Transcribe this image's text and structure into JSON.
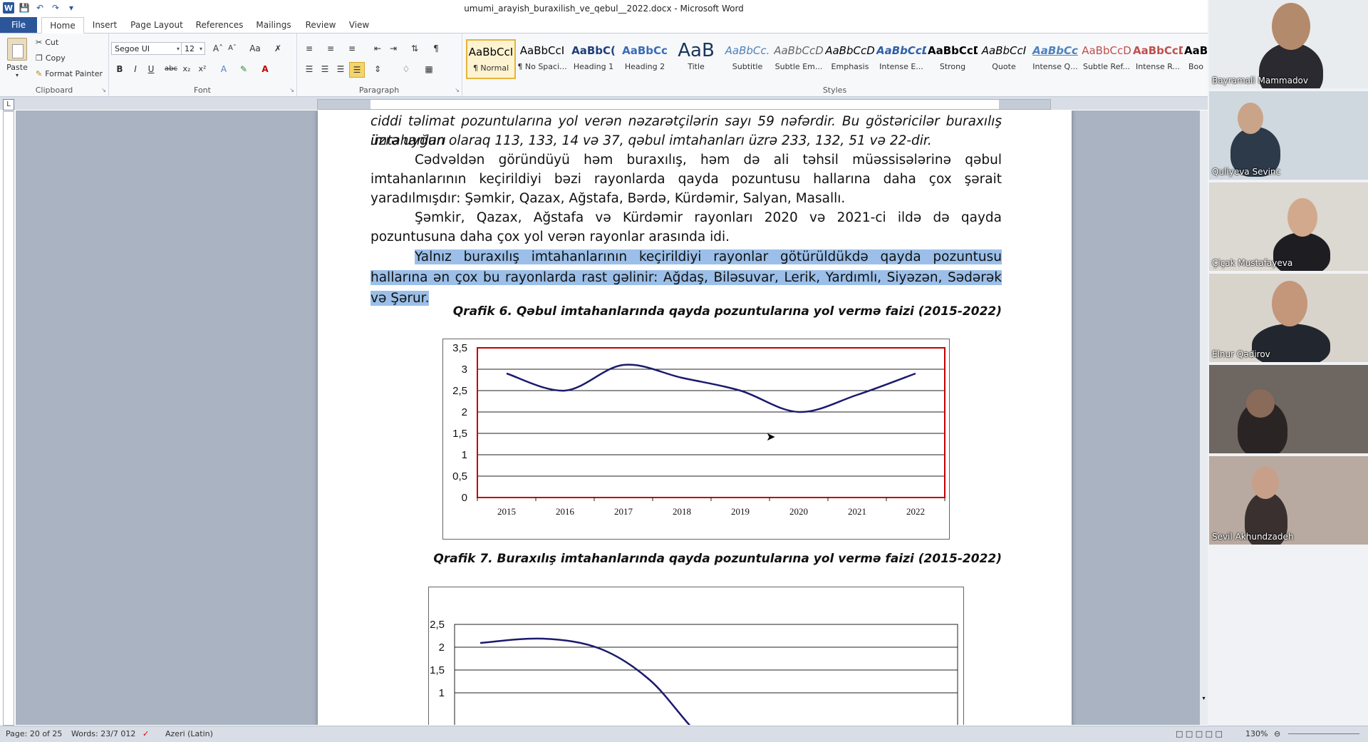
{
  "window": {
    "title": "umumi_arayish_buraxilish_ve_qebul__2022.docx - Microsoft Word",
    "app_icon_letter": "W"
  },
  "tabs": [
    "File",
    "Home",
    "Insert",
    "Page Layout",
    "References",
    "Mailings",
    "Review",
    "View"
  ],
  "ribbon": {
    "clipboard": {
      "paste": "Paste",
      "cut": "Cut",
      "copy": "Copy",
      "format_painter": "Format Painter",
      "label": "Clipboard"
    },
    "font": {
      "name": "Segoe UI",
      "size": "12",
      "label": "Font"
    },
    "paragraph": {
      "label": "Paragraph"
    },
    "styles": {
      "label": "Styles",
      "items": [
        {
          "sample": "AaBbCcI",
          "name": "¶ Normal"
        },
        {
          "sample": "AaBbCcI",
          "name": "¶ No Spaci..."
        },
        {
          "sample": "AaBbC(",
          "name": "Heading 1"
        },
        {
          "sample": "AaBbCc",
          "name": "Heading 2"
        },
        {
          "sample": "AaB",
          "name": "Title"
        },
        {
          "sample": "AaBbCc.",
          "name": "Subtitle"
        },
        {
          "sample": "AaBbCcD",
          "name": "Subtle Em..."
        },
        {
          "sample": "AaBbCcD",
          "name": "Emphasis"
        },
        {
          "sample": "AaBbCcD",
          "name": "Intense E..."
        },
        {
          "sample": "AaBbCcD",
          "name": "Strong"
        },
        {
          "sample": "AaBbCcI",
          "name": "Quote"
        },
        {
          "sample": "AaBbCc",
          "name": "Intense Q..."
        },
        {
          "sample": "AaBbCcD",
          "name": "Subtle Ref..."
        },
        {
          "sample": "AaBbCcD",
          "name": "Intense R..."
        },
        {
          "sample": "AaB",
          "name": "Boo"
        }
      ]
    }
  },
  "document": {
    "line1": "ciddi təlimat pozuntularına yol verən nəzarətçilərin sayı 59 nəfərdir.  Bu göstəricilər buraxılış imtahanları",
    "line2": "üzrə uyğun olaraq 113, 133, 14 və 37, qəbul imtahanları üzrə 233, 132, 51 və 22-dir.",
    "para2": "Cədvəldən göründüyü həm buraxılış, həm də ali təhsil müəssisələrinə qəbul imtahanlarının keçirildiyi bəzi rayonlarda qayda pozuntusu hallarına daha çox şərait yaradılmışdır: Şəmkir, Qazax, Ağstafa, Bərdə, Kürdəmir, Salyan, Masallı.",
    "para3": "Şəmkir, Qazax, Ağstafa və Kürdəmir rayonları 2020 və 2021-ci ildə də qayda pozuntusuna daha çox yol verən rayonlar arasında idi.",
    "para4": "Yalnız buraxılış imtahanlarının keçirildiyi rayonlar götürüldükdə qayda pozuntusu hallarına ən çox bu rayonlarda rast gəlinir: Ağdaş, Biləsuvar, Lerik, Yardımlı, Siyəzən, Sədərək və Şərur.",
    "caption6": "Qrafik 6. Qəbul imtahanlarında qayda pozuntularına yol vermə faizi (2015-2022)",
    "caption7": "Qrafik 7. Buraxılış imtahanlarında qayda pozuntularına yol vermə faizi (2015-2022)"
  },
  "chart_data": [
    {
      "type": "line",
      "title": "",
      "categories": [
        "2015",
        "2016",
        "2017",
        "2018",
        "2019",
        "2020",
        "2021",
        "2022"
      ],
      "values": [
        2.9,
        2.5,
        3.1,
        2.8,
        2.5,
        2.0,
        2.4,
        2.9
      ],
      "ylim": [
        0,
        3.5
      ],
      "yticks": [
        "0",
        "0,5",
        "1",
        "1,5",
        "2",
        "2,5",
        "3",
        "3,5"
      ],
      "line_color": "#1a1a6e",
      "frame_color": "#c00000",
      "grid": true
    },
    {
      "type": "line",
      "title": "",
      "partial": true,
      "yticks": [
        "1",
        "1,5",
        "2",
        "2,5"
      ],
      "ylim": [
        1,
        2.5
      ],
      "line_color": "#1a1a6e",
      "grid": true
    }
  ],
  "statusbar": {
    "page": "Page: 20 of 25",
    "words": "Words: 23/7 012",
    "language": "Azeri (Latin)",
    "zoom": "130%"
  },
  "participants": [
    {
      "name": "Bayramali Mammadov"
    },
    {
      "name": "Quliyeva Sevinc"
    },
    {
      "name": "Çiçak Mustafayeva"
    },
    {
      "name": "Elnur Qədirov"
    },
    {
      "name": ""
    },
    {
      "name": "Sevil Akhundzadeh"
    }
  ]
}
